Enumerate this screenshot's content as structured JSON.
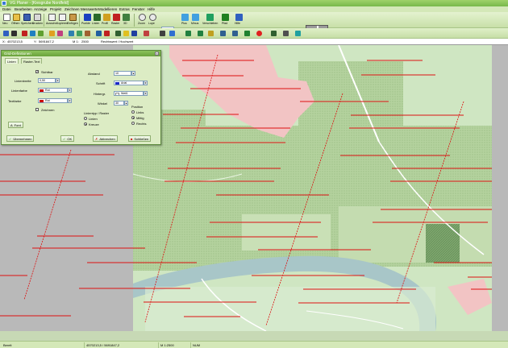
{
  "window": {
    "title": "VG Planer - [Kiesgrube Nordfeld]"
  },
  "menu": [
    "Datei",
    "Bearbeiten",
    "Anzeige",
    "Projekt",
    "Zeichnen",
    "Messwerte",
    "Modellieren",
    "Extras",
    "Fenster",
    "Hilfe"
  ],
  "toolbar": {
    "zoom_value": "1",
    "labels": [
      "Neu",
      "Öffnen",
      "Speichern",
      "Drucken",
      "Ausschn.",
      "Kopieren",
      "Einfügen",
      "Punkte",
      "Linien",
      "Profil",
      "Raster",
      "3D",
      "Zoom",
      "Lupe",
      "Plus",
      "Minus",
      "Verschieben",
      "Pfad",
      "Hilfe"
    ]
  },
  "coords": {
    "x_label": "X:",
    "x_value": "4570213,5",
    "y_label": "Y:",
    "y_value": "5691847,2",
    "scale_label": "M 1:",
    "scale_value": "2500",
    "extra": "Rechtswert / Hochwert"
  },
  "dialog": {
    "title": "Grid-Definitionen",
    "tabs": [
      "Linien",
      "Raster-Text"
    ],
    "visible_label": "Sichtbar",
    "visible_checked": true,
    "line_width_label": "Linienbreite",
    "line_width_value": "0,50",
    "line_color_label": "Linienfarbe",
    "line_color_value": "Rot",
    "line_color_hex": "#cc0000",
    "text_color_label": "Textfarbe",
    "text_color_value": "Rot",
    "text_color_hex": "#cc0000",
    "draw_label": "Zeichnen",
    "label_interval_label": "Abstand",
    "label_interval_value": "10",
    "font_label": "Schrift",
    "font_value": "Arial",
    "font_color_hex": "#1a28c8",
    "background_label": "Hintergr.",
    "background_value": "Weiß",
    "angle_label": "Winkel",
    "angle_value": "30",
    "position_label": "Position",
    "position_options": [
      "Links",
      "Mittig",
      "Rechts"
    ],
    "position_selected": 1,
    "grid_type_label": "Linientyp / Raster",
    "grid_type_options": [
      "Linien",
      "Kreuze"
    ],
    "grid_type_selected": 1,
    "font_button": "Font",
    "buttons": {
      "apply": "Übernehmen",
      "ok": "OK",
      "cancel": "Abbrechen",
      "close": "Schließen"
    }
  },
  "status": {
    "ready": "Bereit",
    "coords": "4570213,5 / 5691847,2",
    "scale": "M 1:2500",
    "mode": "NUM"
  },
  "colors": {
    "grid_line": "#dd1111",
    "map_green": "#cfe6c2",
    "forest": "#b4d29e",
    "water": "#a8c6c8",
    "pink": "#f2c4c4",
    "accent": "#78b84a"
  }
}
